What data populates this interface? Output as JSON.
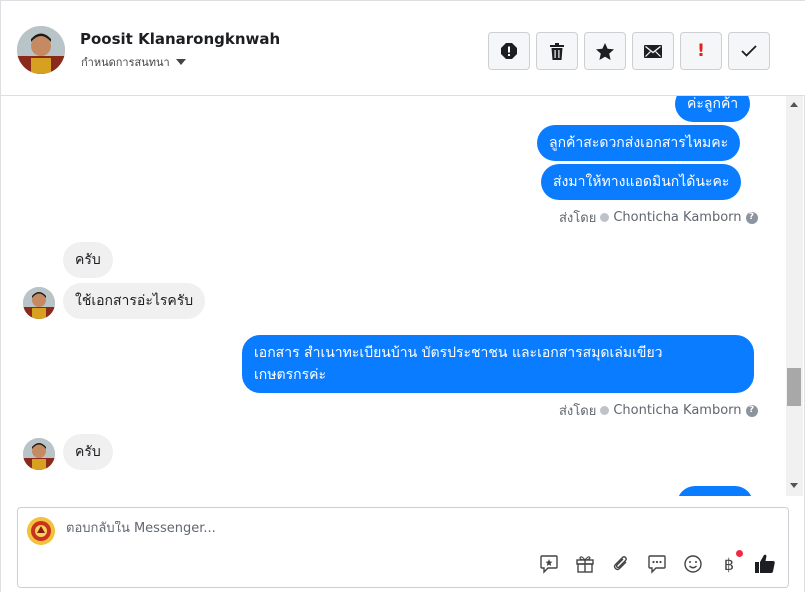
{
  "header": {
    "contact_name": "Poosit Klanarongknwah",
    "status_text": "กำหนดการสนทนา",
    "actions": [
      {
        "name": "report-icon"
      },
      {
        "name": "trash-icon"
      },
      {
        "name": "star-icon"
      },
      {
        "name": "envelope-icon"
      },
      {
        "name": "exclamation-icon",
        "glyph": "!",
        "color": "#e0221c"
      },
      {
        "name": "check-icon"
      }
    ]
  },
  "messages": {
    "out_1": "ค่ะลูกค้า",
    "out_2": "ลูกค้าสะดวกส่งเอกสารไหมคะ",
    "out_3": "ส่งมาให้ทางแอดมินกได้นะคะ",
    "sent_by_label": "ส่งโดย",
    "sender_name": "Chonticha Kamborn",
    "in_1": "ครับ",
    "in_2": "ใช้เอกสารอ่ะไรครับ",
    "out_4_line1": "เอกสาร สำเนาทะเบียนบ้าน บัตรประชาชน และเอกสารสมุดเล่มเขียว",
    "out_4_line2": "เกษตรกรค่ะ",
    "in_3": "ครับ"
  },
  "composer": {
    "placeholder": "ตอบกลับใน Messenger...",
    "baht_glyph": "฿",
    "tools": [
      "sticker-icon",
      "gift-icon",
      "paperclip-icon",
      "chat-bubble-icon",
      "emoji-icon",
      "baht-icon",
      "like-icon"
    ]
  },
  "colors": {
    "outgoing_bubble": "#0a7cff",
    "incoming_bubble": "#f0f0f0",
    "alert_red": "#e0221c"
  }
}
